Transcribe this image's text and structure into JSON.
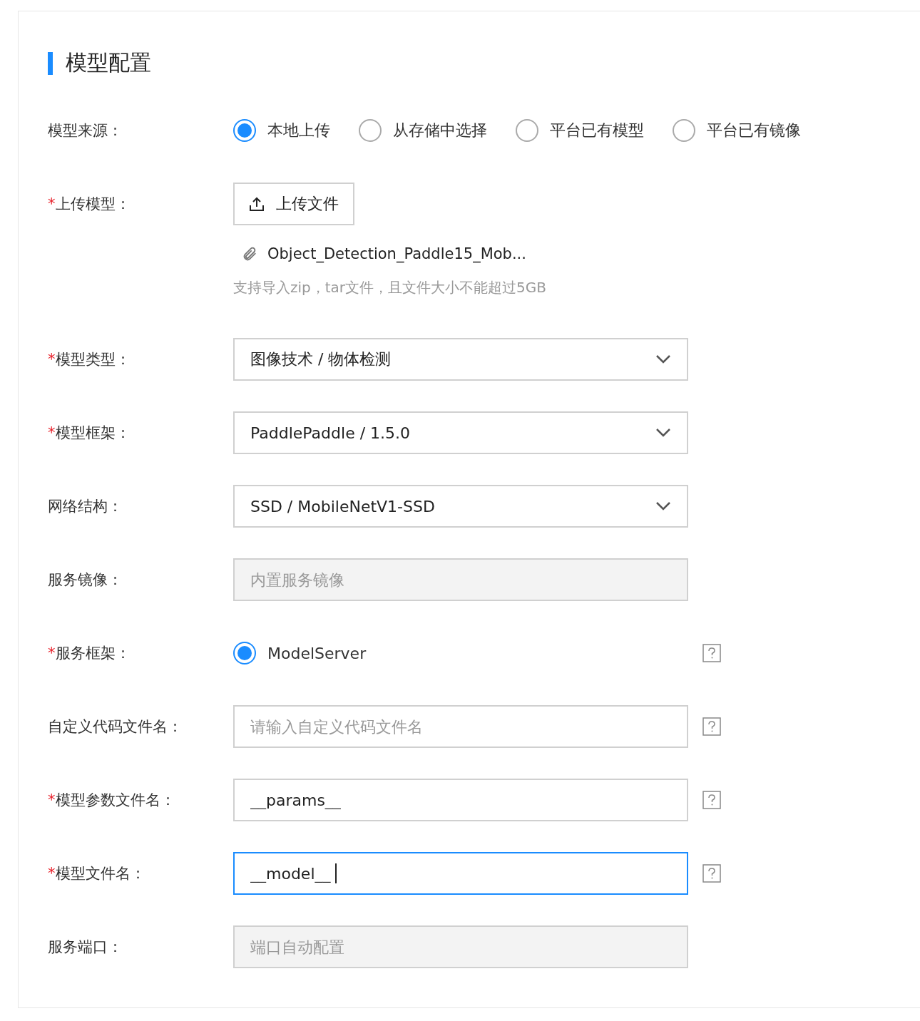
{
  "section": {
    "title": "模型配置"
  },
  "fields": [
    {
      "kind": "radio",
      "label": "模型来源：",
      "options": [
        {
          "label": "本地上传",
          "selected": true
        },
        {
          "label": "从存储中选择",
          "selected": false
        },
        {
          "label": "平台已有模型",
          "selected": false
        },
        {
          "label": "平台已有镜像",
          "selected": false
        }
      ]
    },
    {
      "kind": "upload",
      "marker": "*",
      "label": "上传模型：",
      "button": "上传文件",
      "file": "Object_Detection_Paddle15_Mob...",
      "hint": "支持导入zip，tar文件，且文件大小不能超过5GB"
    },
    {
      "kind": "select",
      "marker": "*",
      "label": "模型类型：",
      "value": "图像技术 / 物体检测"
    },
    {
      "kind": "select",
      "marker": "*",
      "label": "模型框架：",
      "value": "PaddlePaddle / 1.5.0"
    },
    {
      "kind": "select",
      "label": "网络结构：",
      "value": "SSD / MobileNetV1-SSD"
    },
    {
      "kind": "input",
      "label": "服务镜像：",
      "disabled": true,
      "focused": false,
      "placeholder": "内置服务镜像"
    },
    {
      "kind": "radio",
      "marker": "*",
      "label": "服务框架：",
      "help": true,
      "options": [
        {
          "label": "ModelServer",
          "selected": true
        }
      ]
    },
    {
      "kind": "input",
      "label": "自定义代码文件名：",
      "help": true,
      "disabled": false,
      "focused": false,
      "placeholder": "请输入自定义代码文件名"
    },
    {
      "kind": "input",
      "marker": "*",
      "label": "模型参数文件名：",
      "help": true,
      "disabled": false,
      "focused": false,
      "value": "__params__"
    },
    {
      "kind": "input",
      "marker": "*",
      "label": "模型文件名：",
      "help": true,
      "disabled": false,
      "focused": true,
      "value": "__model__"
    },
    {
      "kind": "input",
      "label": "服务端口：",
      "disabled": true,
      "focused": false,
      "placeholder": "端口自动配置"
    }
  ]
}
